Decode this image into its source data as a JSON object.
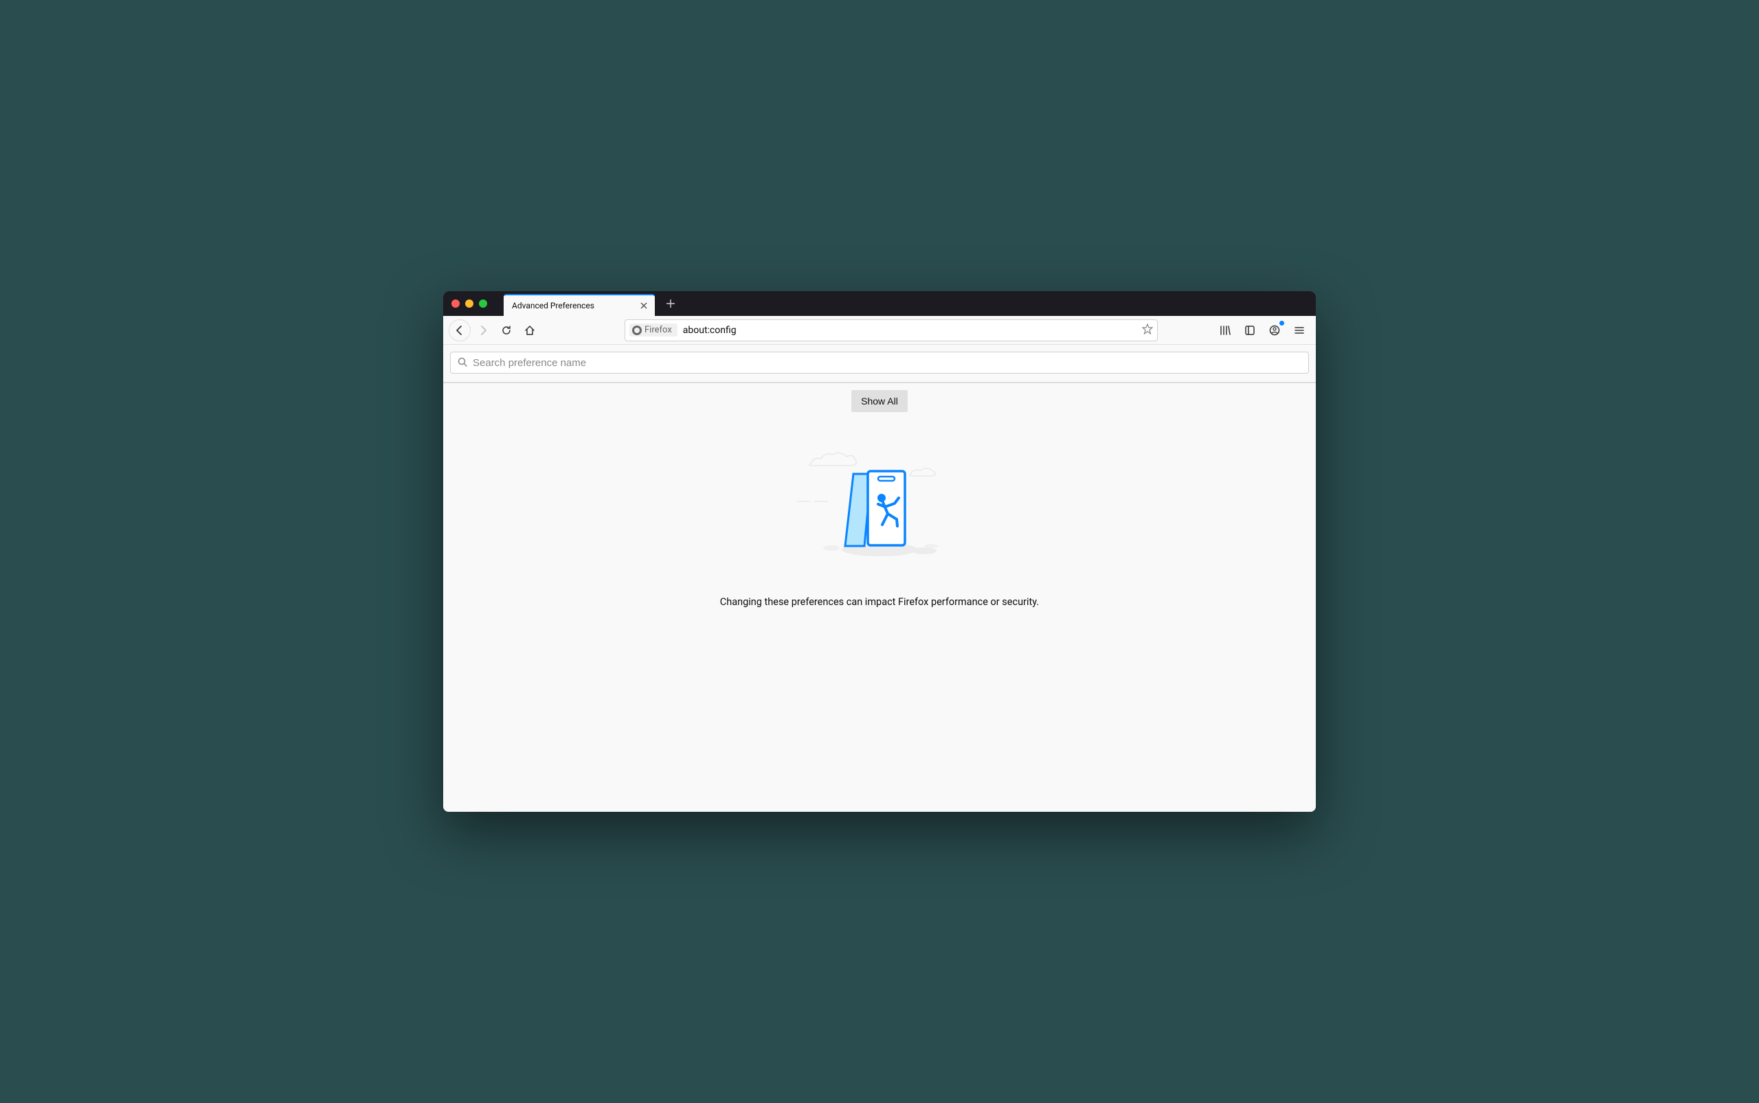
{
  "tab": {
    "title": "Advanced Preferences"
  },
  "address_bar": {
    "identity_label": "Firefox",
    "url": "about:config"
  },
  "search": {
    "placeholder": "Search preference name"
  },
  "main": {
    "show_all_label": "Show All",
    "warning_text": "Changing these preferences can impact Firefox performance or security."
  }
}
